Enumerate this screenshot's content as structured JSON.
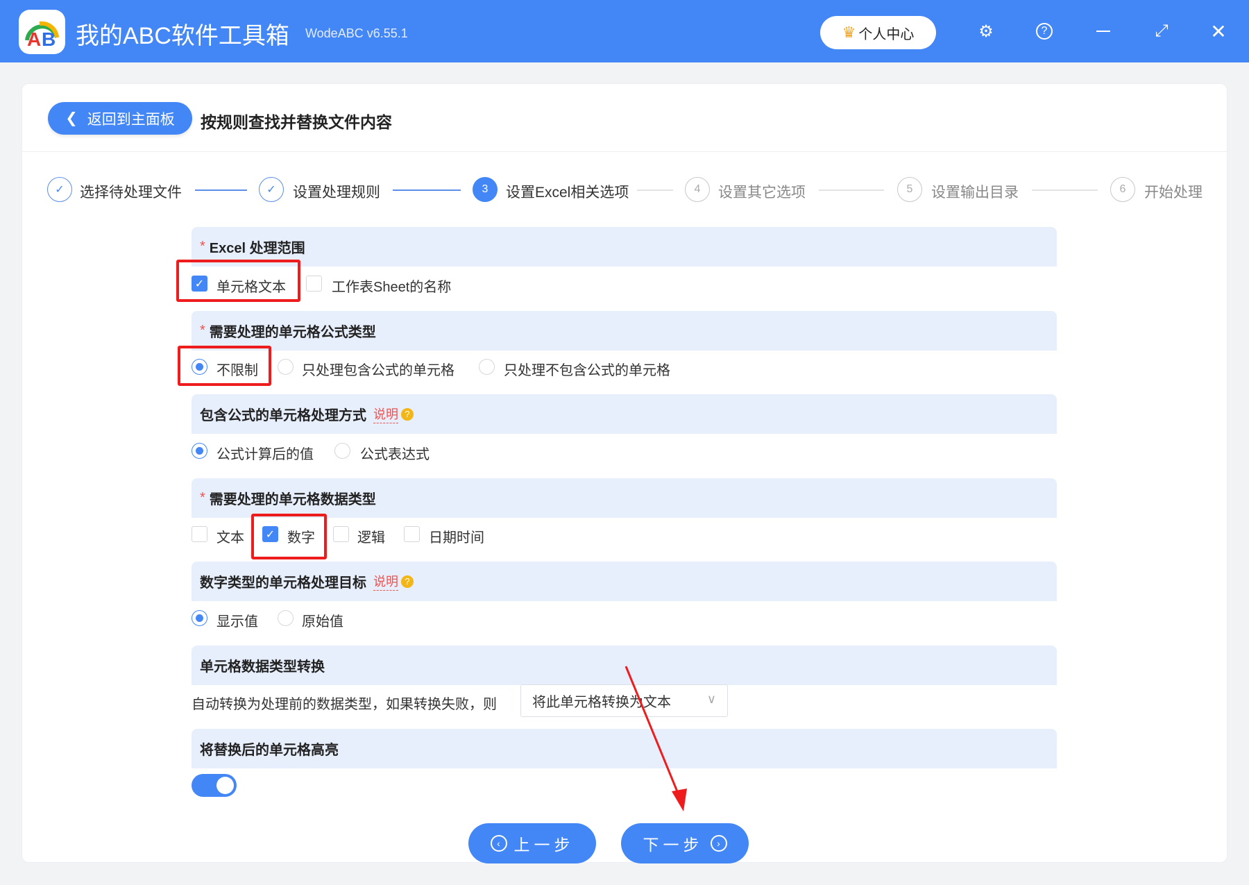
{
  "app": {
    "title": "我的ABC软件工具箱",
    "version": "WodeABC v6.55.1",
    "user_center": "个人中心",
    "logo_text": "AB"
  },
  "header": {
    "back": "返回到主面板",
    "title": "按规则查找并替换文件内容"
  },
  "steps": [
    {
      "num": "1",
      "label": "选择待处理文件",
      "state": "done"
    },
    {
      "num": "2",
      "label": "设置处理规则",
      "state": "done"
    },
    {
      "num": "3",
      "label": "设置Excel相关选项",
      "state": "active"
    },
    {
      "num": "4",
      "label": "设置其它选项",
      "state": "todo"
    },
    {
      "num": "5",
      "label": "设置输出目录",
      "state": "todo"
    },
    {
      "num": "6",
      "label": "开始处理",
      "state": "todo"
    }
  ],
  "sections": {
    "range": {
      "title": "Excel 处理范围",
      "required": "*",
      "options": [
        "单元格文本",
        "工作表Sheet的名称"
      ],
      "checked": [
        true,
        false
      ]
    },
    "formula_type": {
      "title": "需要处理的单元格公式类型",
      "required": "*",
      "options": [
        "不限制",
        "只处理包含公式的单元格",
        "只处理不包含公式的单元格"
      ],
      "selected": 0
    },
    "formula_mode": {
      "title": "包含公式的单元格处理方式",
      "hint": "说明",
      "options": [
        "公式计算后的值",
        "公式表达式"
      ],
      "selected": 0
    },
    "data_type": {
      "title": "需要处理的单元格数据类型",
      "required": "*",
      "options": [
        "文本",
        "数字",
        "逻辑",
        "日期时间"
      ],
      "checked": [
        false,
        true,
        false,
        false
      ]
    },
    "number_target": {
      "title": "数字类型的单元格处理目标",
      "hint": "说明",
      "options": [
        "显示值",
        "原始值"
      ],
      "selected": 0
    },
    "convert": {
      "title": "单元格数据类型转换",
      "text": "自动转换为处理前的数据类型，如果转换失败，则",
      "select_value": "将此单元格转换为文本"
    },
    "highlight": {
      "title": "将替换后的单元格高亮",
      "enabled": true
    }
  },
  "footer": {
    "prev": "上一步",
    "next": "下一步"
  },
  "colors": {
    "primary": "#4387f6",
    "section_bg": "#e8effc",
    "annotation": "#ee1c1c"
  }
}
